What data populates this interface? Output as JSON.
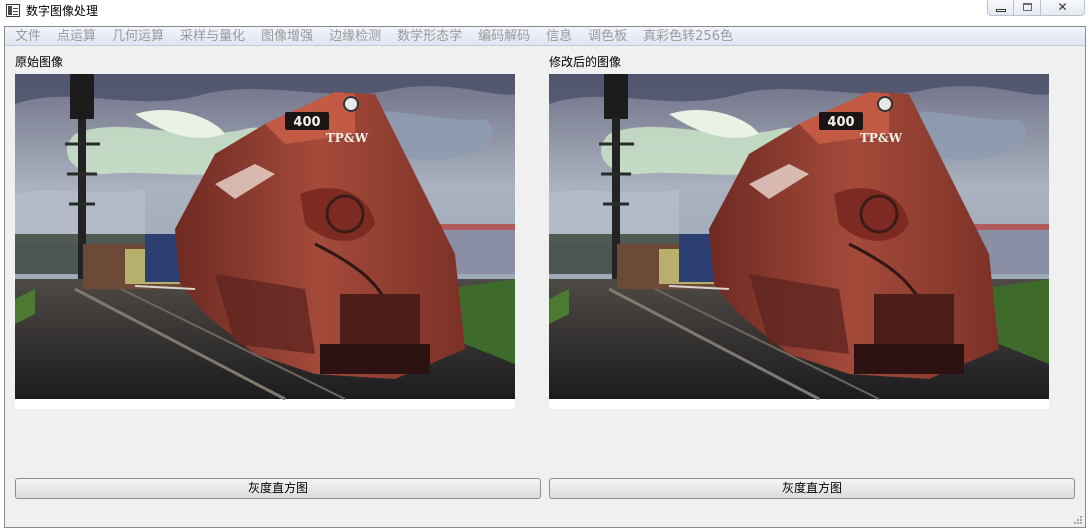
{
  "window": {
    "title": "数字图像处理",
    "close_glyph": "✕"
  },
  "menu": {
    "items": [
      "文件",
      "点运算",
      "几何运算",
      "采样与量化",
      "图像增强",
      "边缘检测",
      "数学形态学",
      "编码解码",
      "信息",
      "调色板",
      "真彩色转256色"
    ]
  },
  "left_panel": {
    "label": "原始图像",
    "button_label": "灰度直方图",
    "image_content": "photo-locomotive",
    "locomotive_number": "400",
    "locomotive_logo": "TP&W"
  },
  "right_panel": {
    "label": "修改后的图像",
    "button_label": "灰度直方图",
    "image_content": "photo-locomotive",
    "locomotive_number": "400",
    "locomotive_logo": "TP&W"
  },
  "icons": {
    "app": "app-window-icon",
    "minimize": "minimize-icon",
    "maximize": "maximize-icon",
    "close": "close-icon",
    "resize": "resize-grip-icon"
  }
}
